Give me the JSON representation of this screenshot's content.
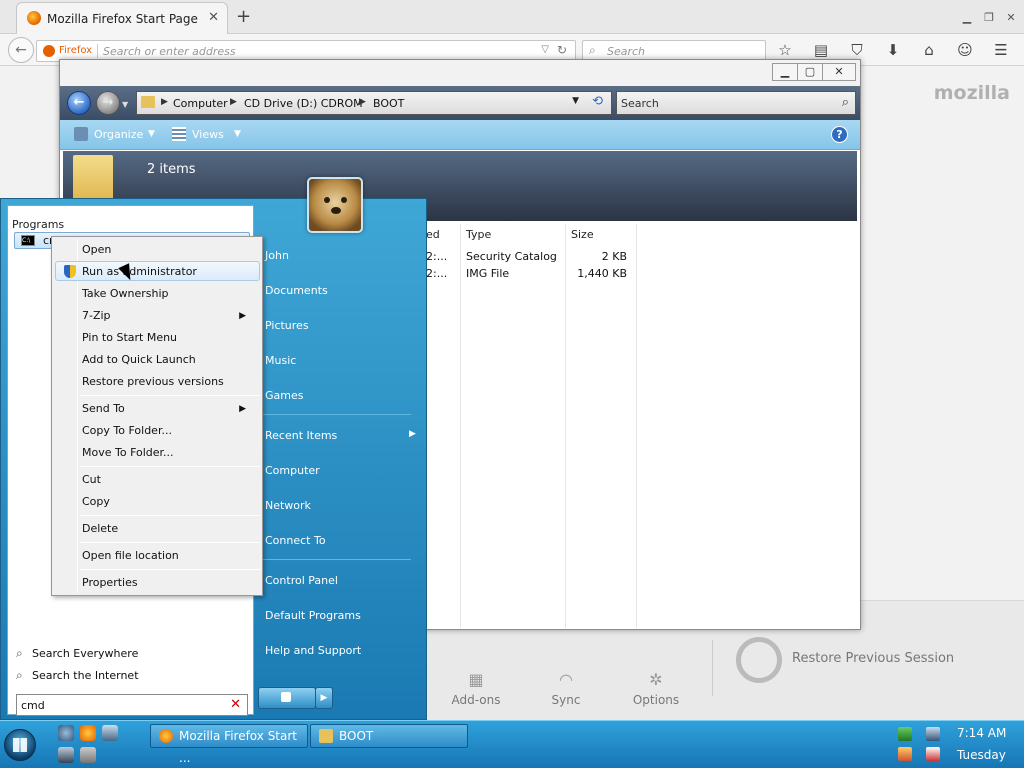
{
  "firefox": {
    "tab_title": "Mozilla Firefox Start Page",
    "url_identity": "Firefox",
    "url_placeholder": "Search or enter address",
    "search_placeholder": "Search",
    "brand": "mozilla",
    "launcher": [
      {
        "label": "Add-ons"
      },
      {
        "label": "Sync"
      },
      {
        "label": "Options"
      }
    ],
    "restore_session": "Restore Previous Session"
  },
  "explorer": {
    "breadcrumbs": [
      "Computer",
      "CD Drive (D:) CDROM",
      "BOOT"
    ],
    "search_placeholder": "Search",
    "toolbar": {
      "organize": "Organize",
      "views": "Views"
    },
    "item_count": "2 items",
    "columns": {
      "modified": "ed",
      "type": "Type",
      "size": "Size"
    },
    "rows": [
      {
        "modified": "2:...",
        "type": "Security Catalog",
        "size": "2 KB"
      },
      {
        "modified": "2:...",
        "type": "IMG File",
        "size": "1,440 KB"
      }
    ]
  },
  "start_menu": {
    "programs_label": "Programs",
    "result": "cmd.exe",
    "user": "John",
    "right_items": [
      "Documents",
      "Pictures",
      "Music",
      "Games",
      "Recent Items",
      "Computer",
      "Network",
      "Connect To",
      "Control Panel",
      "Default Programs",
      "Help and Support"
    ],
    "search_everywhere": "Search Everywhere",
    "search_internet": "Search the Internet",
    "search_value": "cmd"
  },
  "context_menu": {
    "items": [
      "Open",
      "Run as administrator",
      "Take Ownership",
      "7-Zip",
      "Pin to Start Menu",
      "Add to Quick Launch",
      "Restore previous versions",
      "Send To",
      "Copy To Folder...",
      "Move To Folder...",
      "Cut",
      "Copy",
      "Delete",
      "Open file location",
      "Properties"
    ]
  },
  "taskbar": {
    "buttons": [
      "Mozilla Firefox Start ...",
      "BOOT"
    ],
    "time": "7:14 AM",
    "day": "Tuesday"
  },
  "colors": {
    "accent": "#1a79b2",
    "firefox_orange": "#e66000"
  }
}
